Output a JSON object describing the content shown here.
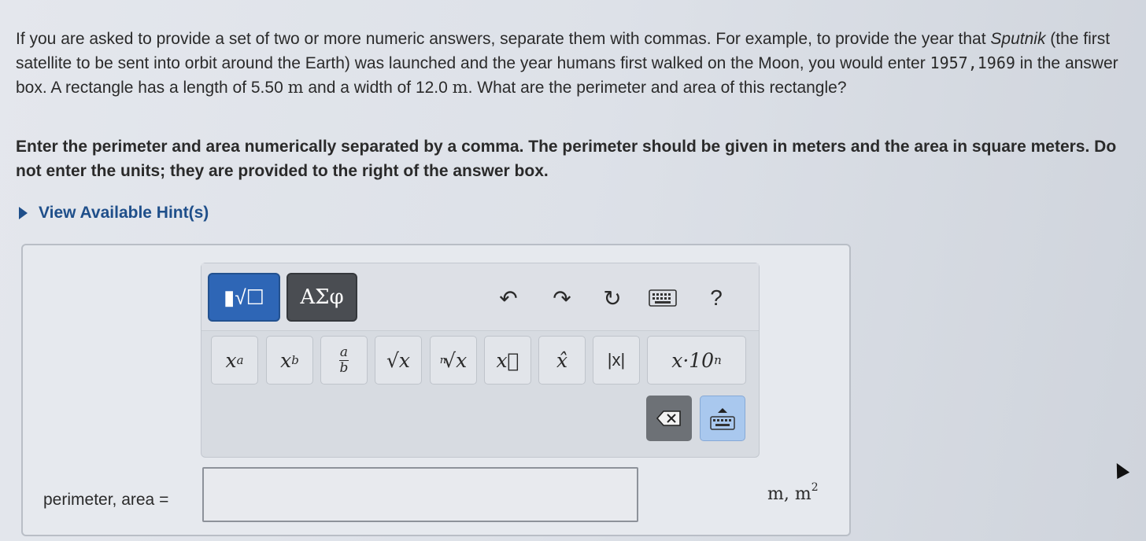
{
  "question": {
    "part1": "If you are asked to provide a set of two or more numeric answers, separate them with commas. For example, to provide the year that ",
    "sputnik": "Sputnik",
    "part2": " (the first satellite to be sent into orbit around the Earth) was launched and the year humans first walked on the Moon, you would enter ",
    "example_answer": "1957,1969",
    "part3": " in the answer box. A rectangle has a length of 5.50 ",
    "unit_m1": "m",
    "part4": " and a width of 12.0 ",
    "unit_m2": "m",
    "part5": ". What are the perimeter and area of this rectangle?"
  },
  "instruction": "Enter the perimeter and area numerically separated by a comma. The perimeter should be given in meters and the area in square meters. Do not enter the units; they are provided to the right of the answer box.",
  "hints": {
    "label": "View Available Hint(s)"
  },
  "toolbar": {
    "templates_label": "▮√☐",
    "symbols_label": "ΑΣφ",
    "undo": "↶",
    "redo": "↷",
    "reset": "↻",
    "help": "?",
    "keys": {
      "power_base": "x",
      "power_exp": "a",
      "subscript_base": "x",
      "subscript_sub": "b",
      "frac_num": "a",
      "frac_den": "b",
      "sqrt": "√x",
      "nthroot_index": "n",
      "nthroot_body": "√x",
      "vector": "x⃗",
      "unit_vector": "x̂",
      "abs": "|x|",
      "sci_notation": "x·10",
      "sci_exp": "n"
    }
  },
  "answer": {
    "label": "perimeter, area =",
    "value": "",
    "units_main": "m, m",
    "units_sup": "2"
  }
}
